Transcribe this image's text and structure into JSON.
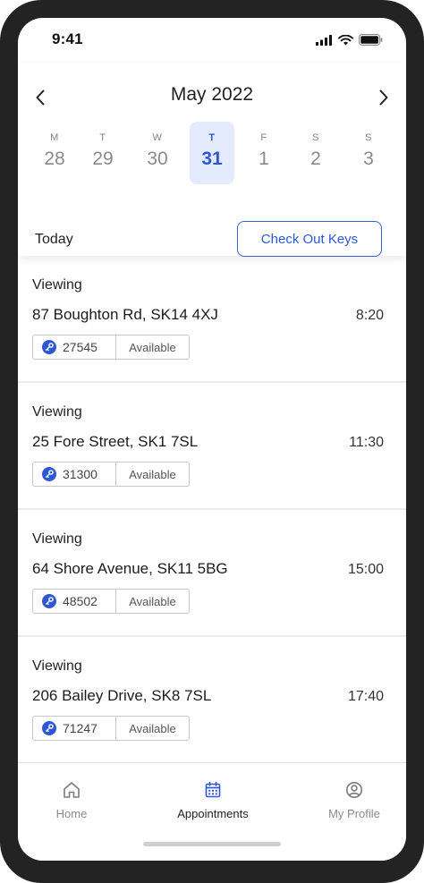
{
  "status_bar": {
    "time": "9:41"
  },
  "calendar": {
    "month_label": "May 2022",
    "days": [
      {
        "dow": "M",
        "date": "28",
        "selected": false
      },
      {
        "dow": "T",
        "date": "29",
        "selected": false
      },
      {
        "dow": "W",
        "date": "30",
        "selected": false
      },
      {
        "dow": "T",
        "date": "31",
        "selected": true
      },
      {
        "dow": "F",
        "date": "1",
        "selected": false
      },
      {
        "dow": "S",
        "date": "2",
        "selected": false
      },
      {
        "dow": "S",
        "date": "3",
        "selected": false
      }
    ]
  },
  "toolbar": {
    "today_label": "Today",
    "checkout_label": "Check Out Keys"
  },
  "appointments": [
    {
      "type": "Viewing",
      "address": "87 Boughton Rd, SK14 4XJ",
      "time": "8:20",
      "key_id": "27545",
      "key_status": "Available"
    },
    {
      "type": "Viewing",
      "address": "25 Fore Street, SK1 7SL",
      "time": "11:30",
      "key_id": "31300",
      "key_status": "Available"
    },
    {
      "type": "Viewing",
      "address": "64 Shore Avenue, SK11 5BG",
      "time": "15:00",
      "key_id": "48502",
      "key_status": "Available"
    },
    {
      "type": "Viewing",
      "address": "206 Bailey Drive, SK8 7SL",
      "time": "17:40",
      "key_id": "71247",
      "key_status": "Available"
    }
  ],
  "tabs": [
    {
      "label": "Home",
      "icon": "home-icon",
      "active": false
    },
    {
      "label": "Appointments",
      "icon": "calendar-icon",
      "active": true
    },
    {
      "label": "My Profile",
      "icon": "profile-icon",
      "active": false
    }
  ],
  "colors": {
    "accent": "#2e57d6",
    "selected_day_bg": "#e4ebfc",
    "bezel": "#232323",
    "list_bg": "#ececec"
  }
}
